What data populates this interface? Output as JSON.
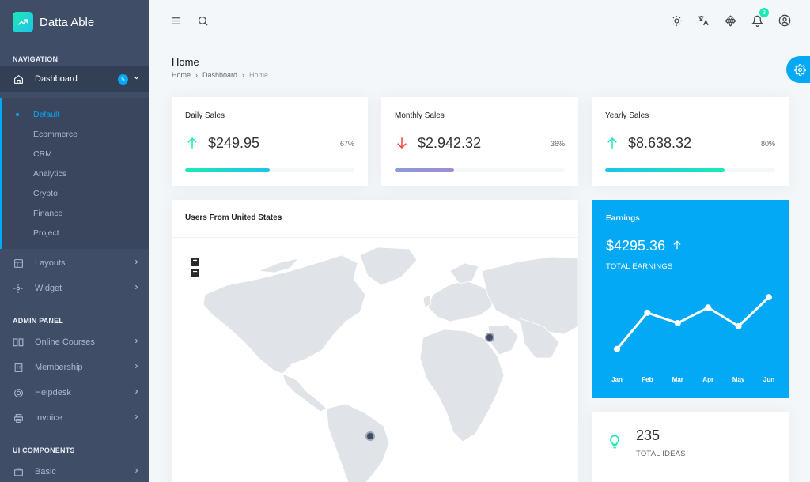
{
  "brand": {
    "name": "Datta Able"
  },
  "sidebar": {
    "sections": {
      "navigation": "NAVIGATION",
      "admin": "ADMIN PANEL",
      "ui": "UI COMPONENTS"
    },
    "dashboard": {
      "label": "Dashboard",
      "badge": "5"
    },
    "submenu": [
      "Default",
      "Ecommerce",
      "CRM",
      "Analytics",
      "Crypto",
      "Finance",
      "Project"
    ],
    "layouts": "Layouts",
    "widget": "Widget",
    "online_courses": "Online Courses",
    "membership": "Membership",
    "helpdesk": "Helpdesk",
    "invoice": "Invoice",
    "basic": "Basic"
  },
  "header": {
    "notification_count": "3"
  },
  "page": {
    "title": "Home",
    "breadcrumb": [
      "Home",
      "Dashboard",
      "Home"
    ]
  },
  "stats": [
    {
      "title": "Daily Sales",
      "value": "$249.95",
      "percent": "67%",
      "progress": 0.5,
      "trend": "up",
      "color": "#1de9b6"
    },
    {
      "title": "Monthly Sales",
      "value": "$2.942.32",
      "percent": "36%",
      "progress": 0.35,
      "trend": "down",
      "color": "#a389d4"
    },
    {
      "title": "Yearly Sales",
      "value": "$8.638.32",
      "percent": "80%",
      "progress": 0.7,
      "trend": "up",
      "color": "#1de9b6"
    }
  ],
  "map": {
    "title": "Users From United States",
    "zoom_in": "+",
    "zoom_out": "−"
  },
  "earnings": {
    "title": "Earnings",
    "value": "$4295.36",
    "subtitle": "TOTAL EARNINGS",
    "chart_data": {
      "type": "line",
      "categories": [
        "Jan",
        "Feb",
        "Mar",
        "Apr",
        "May",
        "Jun"
      ],
      "values": [
        20,
        55,
        45,
        60,
        42,
        70
      ],
      "ylim": [
        0,
        80
      ]
    }
  },
  "ideas": {
    "value": "235",
    "label": "TOTAL IDEAS"
  },
  "colors": {
    "primary": "#04a9f5",
    "sidebar": "#3f4d67",
    "success": "#1de9b6",
    "danger": "#f44236"
  }
}
